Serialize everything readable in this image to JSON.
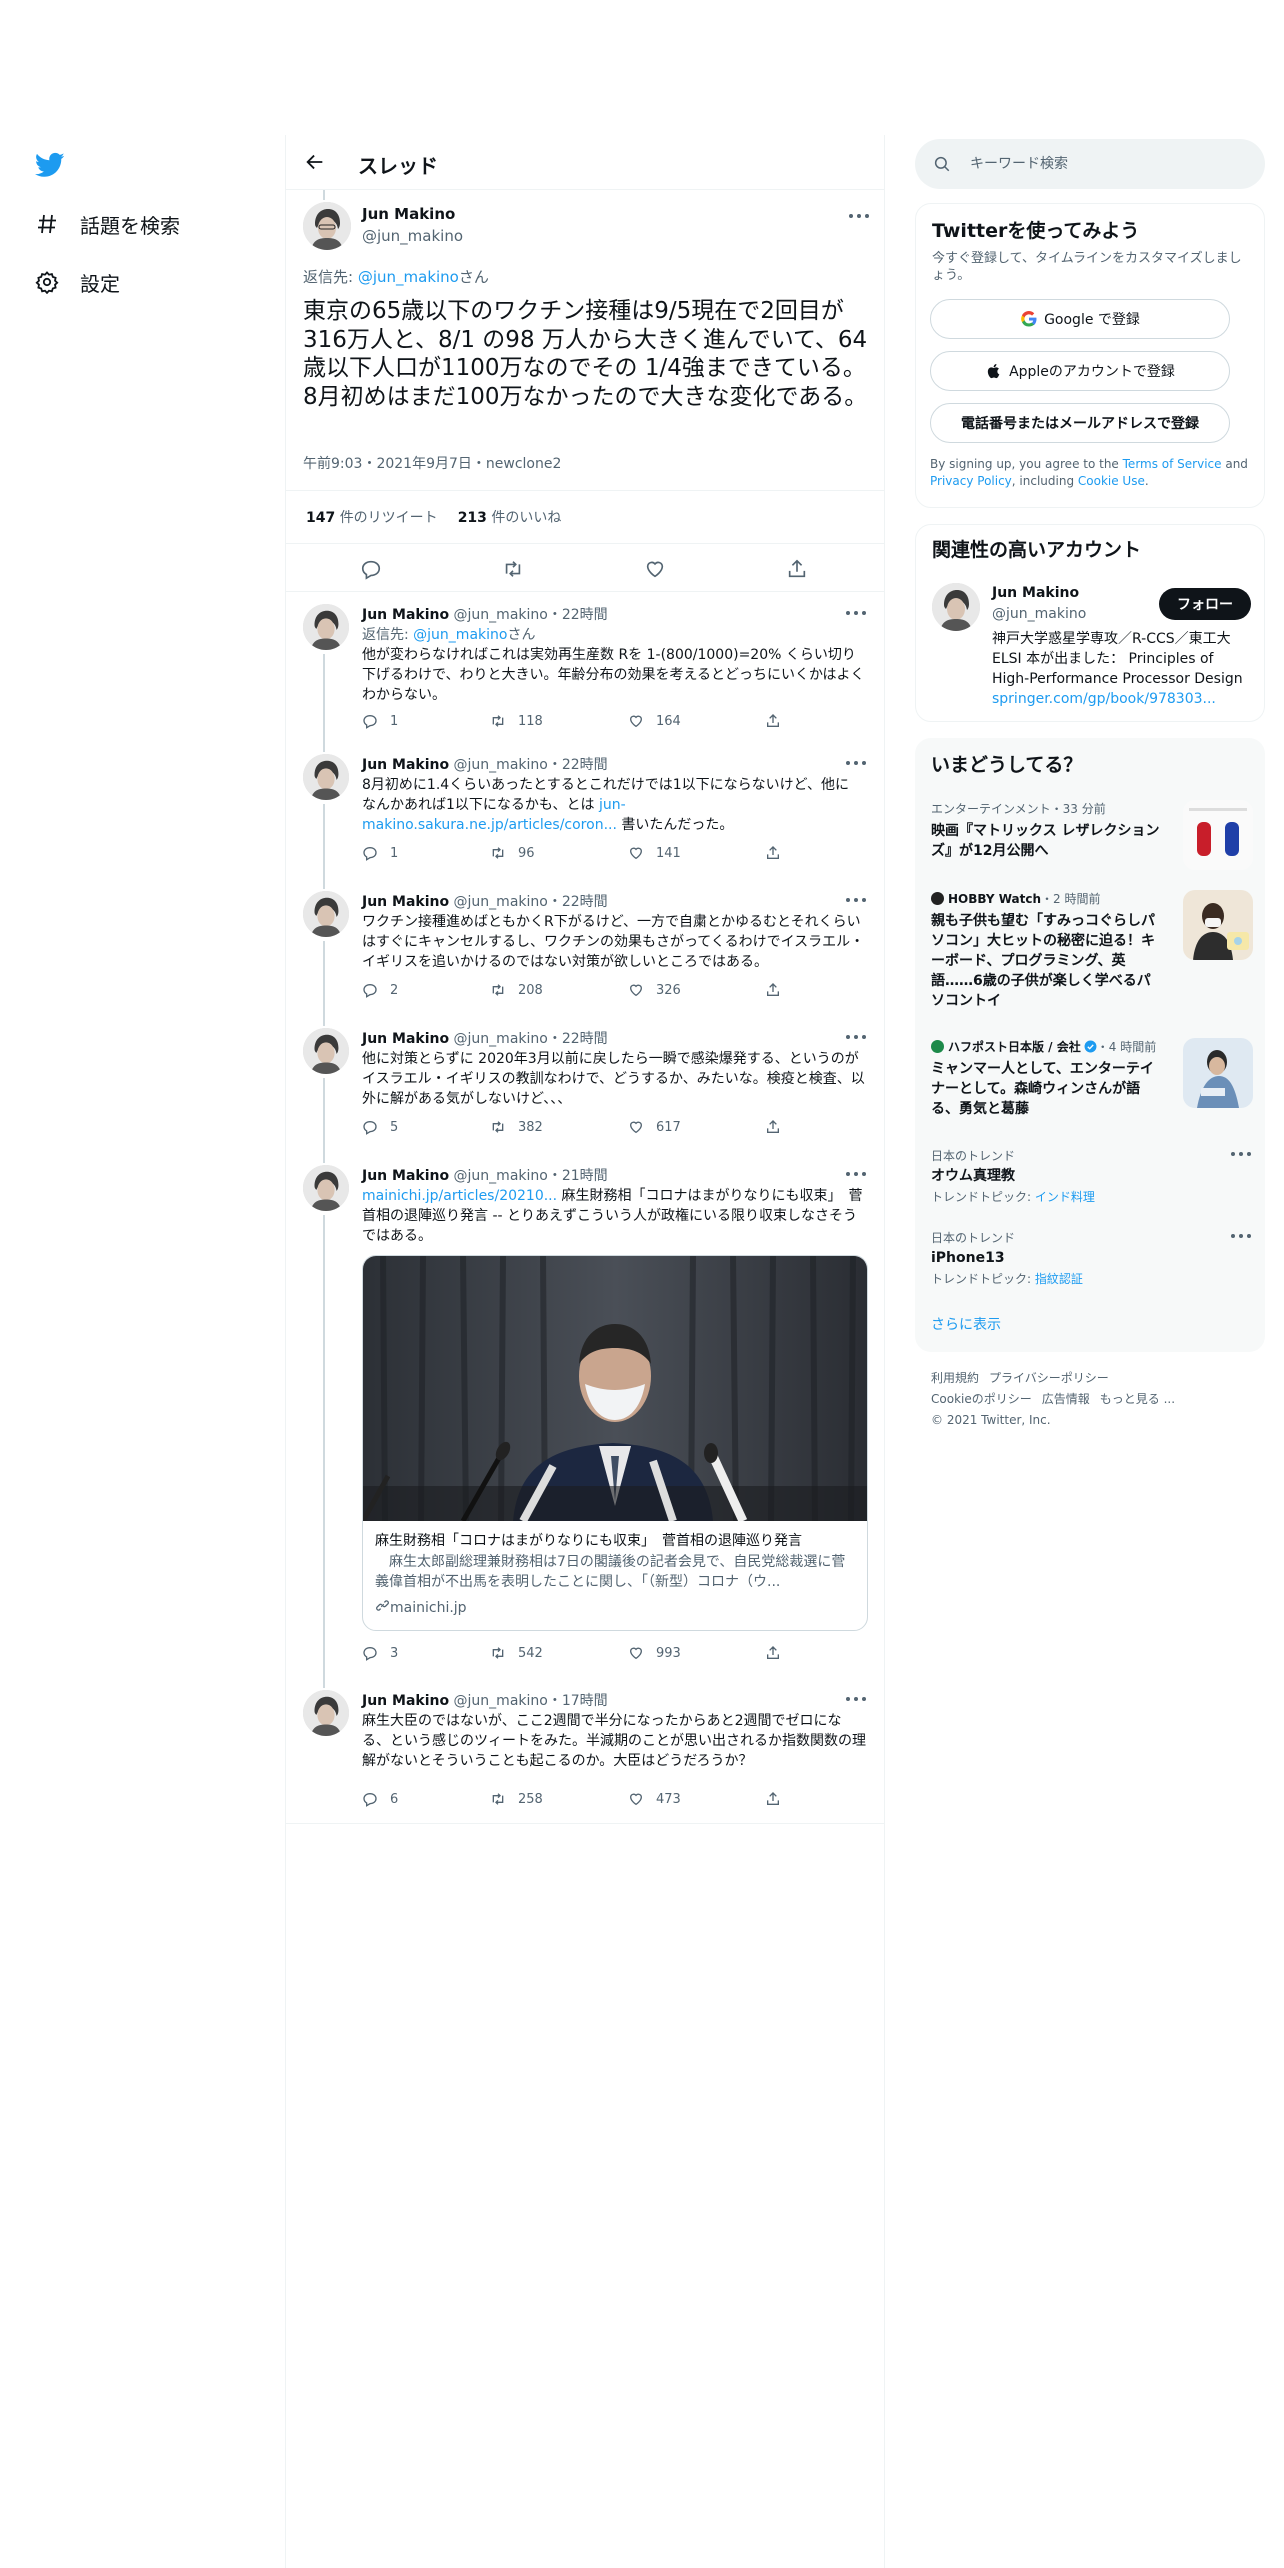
{
  "nav": {
    "explore_label": "話題を検索",
    "settings_label": "設定"
  },
  "header": {
    "title": "スレッド"
  },
  "focused_tweet": {
    "name": "Jun Makino",
    "handle": "@jun_makino",
    "reply_prefix": "返信先: ",
    "reply_to": "@jun_makino",
    "reply_suffix": "さん",
    "text": "東京の65歳以下のワクチン接種は9/5現在で2回目が316万人と、8/1 の98 万人から大きく進んでいて、64歳以下人口が1100万なのでその 1/4強まできている。8月初めはまだ100万なかったので大きな変化である。",
    "timestamp": "午前9:03・2021年9月7日・newclone2",
    "retweets_count": "147",
    "retweets_label": "件のリツイート",
    "likes_count": "213",
    "likes_label": "件のいいね"
  },
  "replies": [
    {
      "name": "Jun Makino",
      "handle": "@jun_makino",
      "time": "22時間",
      "reply_prefix": "返信先: ",
      "reply_to": "@jun_makino",
      "reply_suffix": "さん",
      "text": "他が変わらなければこれは実効再生産数 Rを 1-(800/1000)=20% くらい切り下げるわけで、わりと大きい。年齢分布の効果を考えるとどっちにいくかはよくわからない。",
      "replies": "1",
      "retweets": "118",
      "likes": "164"
    },
    {
      "name": "Jun Makino",
      "handle": "@jun_makino",
      "time": "22時間",
      "text_before": "8月初めに1.4くらいあったとするとこれだけでは1以下にならないけど、他に なんかあれば1以下になるかも、とは ",
      "link": "jun-makino.sakura.ne.jp/articles/coron...",
      "text_after": " 書いたんだった。",
      "replies": "1",
      "retweets": "96",
      "likes": "141"
    },
    {
      "name": "Jun Makino",
      "handle": "@jun_makino",
      "time": "22時間",
      "text": "ワクチン接種進めばともかくR下がるけど、一方で自粛とかゆるむとそれくらいはすぐにキャンセルするし、ワクチンの効果もさがってくるわけでイスラエル・イギリスを追いかけるのではない対策が欲しいところではある。",
      "replies": "2",
      "retweets": "208",
      "likes": "326"
    },
    {
      "name": "Jun Makino",
      "handle": "@jun_makino",
      "time": "22時間",
      "text": "他に対策とらずに 2020年3月以前に戻したら一瞬で感染爆発する、というのがイスラエル・イギリスの教訓なわけで、どうするか、みたいな。検疫と検査、以外に解がある気がしないけど、、、",
      "replies": "5",
      "retweets": "382",
      "likes": "617"
    },
    {
      "name": "Jun Makino",
      "handle": "@jun_makino",
      "time": "21時間",
      "link": "mainichi.jp/articles/20210...",
      "text_after": " 麻生財務相「コロナはまがりなりにも収束」　菅首相の退陣巡り発言 -- とりあえずこういう人が政権にいる限り収束しなさそうではある。",
      "card": {
        "title": "麻生財務相「コロナはまがりなりにも収束」　菅首相の退陣巡り発言",
        "description": "　麻生太郎副総理兼財務相は7日の閣議後の記者会見で、自民党総裁選に菅義偉首相が不出馬を表明したことに関し、「（新型）コロナ（ウ...",
        "domain": "mainichi.jp"
      },
      "replies": "3",
      "retweets": "542",
      "likes": "993"
    },
    {
      "name": "Jun Makino",
      "handle": "@jun_makino",
      "time": "17時間",
      "text": "麻生大臣のではないが、ここ2週間で半分になったからあと2週間でゼロになる、という感じのツィートをみた。半減期のことが思い出されるか指数関数の理解がないとそういうことも起こるのか。大臣はどうだろうか？",
      "replies": "6",
      "retweets": "258",
      "likes": "473"
    }
  ],
  "search": {
    "placeholder": "キーワード検索"
  },
  "signup": {
    "title": "Twitterを使ってみよう",
    "subtitle": "今すぐ登録して、タイムラインをカスタマイズしましょう。",
    "google_label": "Google で登録",
    "apple_label": "Appleのアカウントで登録",
    "phone_label": "電話番号またはメールアドレスで登録",
    "terms_prefix": "By signing up, you agree to the ",
    "terms_link": "Terms of Service",
    "terms_and": " and ",
    "privacy_link": "Privacy Policy",
    "terms_including": ", including ",
    "cookie_link": "Cookie Use",
    "terms_end": "."
  },
  "related": {
    "title": "関連性の高いアカウント",
    "name": "Jun Makino",
    "handle": "@jun_makino",
    "follow_label": "フォロー",
    "bio": "神戸大学惑星学専攻／R-CCS／東工大ELSI 本が出ました： Principles of High-Performance Processor Design ",
    "bio_link": "springer.com/gp/book/978303..."
  },
  "trends": {
    "title": "いまどうしてる？",
    "items": [
      {
        "meta": "エンターテインメント・33 分前",
        "title": "映画『マトリックス レザレクションズ』が12月公開へ"
      },
      {
        "source": "HOBBY Watch",
        "time": "・2 時間前",
        "title": "親も子供も望む「すみっコぐらしパソコン」大ヒットの秘密に迫る！キーボード、プログラミング、英語……6歳の子供が楽しく学べるパソコントイ"
      },
      {
        "source": "ハフポスト日本版 / 会社",
        "time": "・4 時間前",
        "title": "ミャンマー人として、エンターテイナーとして。森崎ウィンさんが語る、勇気と葛藤"
      },
      {
        "meta": "日本のトレンド",
        "title": "オウム真理教",
        "sub_prefix": "トレンドトピック: ",
        "sub_link": "インド料理"
      },
      {
        "meta": "日本のトレンド",
        "title": "iPhone13",
        "sub_prefix": "トレンドトピック: ",
        "sub_link": "指紋認証"
      }
    ],
    "show_more": "さらに表示"
  },
  "footer": {
    "terms": "利用規約",
    "privacy": "プライバシーポリシー",
    "cookie": "Cookieのポリシー",
    "ads": "広告情報",
    "more": "もっと見る ...",
    "copyright": "© 2021 Twitter, Inc."
  },
  "colors": {
    "accent": "#1d9bf0",
    "text": "#0f1419",
    "muted": "#536471"
  },
  "icons": [
    "twitter-bird-icon",
    "hashtag-icon",
    "gear-icon",
    "back-arrow-icon",
    "more-icon",
    "reply-icon",
    "retweet-icon",
    "like-icon",
    "share-icon",
    "search-icon",
    "google-icon",
    "apple-icon",
    "link-icon",
    "verified-icon"
  ]
}
